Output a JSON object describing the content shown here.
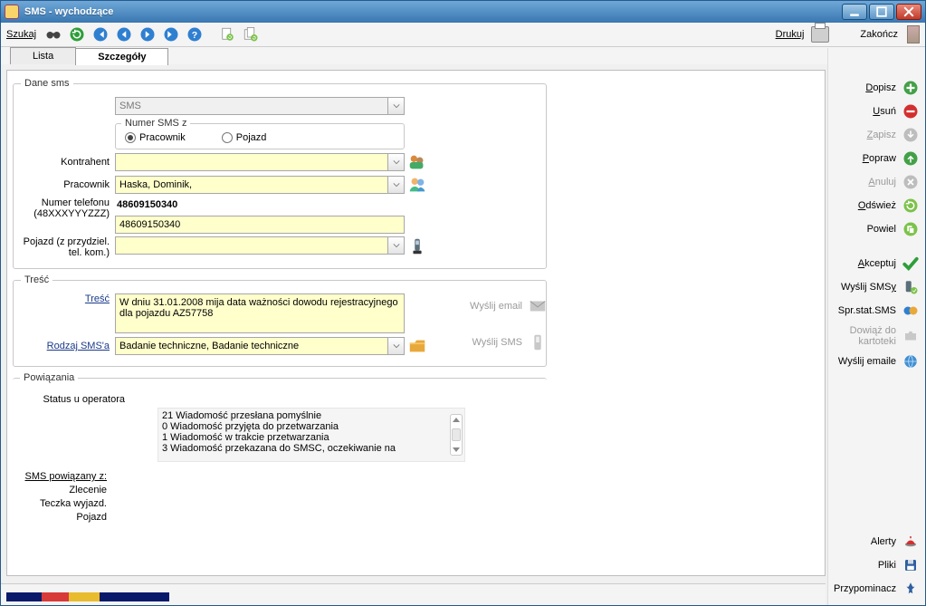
{
  "window": {
    "title": "SMS - wychodzące"
  },
  "toolbar": {
    "search_label": "Szukaj",
    "print_label": "Drukuj",
    "exit_label": "Zakończ"
  },
  "tabs": {
    "list": "Lista",
    "details": "Szczegóły"
  },
  "groups": {
    "dane": "Dane sms",
    "numer": "Numer SMS z",
    "tresc": "Treść",
    "powiazania": "Powiązania"
  },
  "fields": {
    "type_value": "SMS",
    "radio_pracownik": "Pracownik",
    "radio_pojazd": "Pojazd",
    "kontrahent_label": "Kontrahent",
    "kontrahent_value": "",
    "pracownik_label": "Pracownik",
    "pracownik_value": "Haska, Dominik,",
    "telefon_label_l1": "Numer telefonu",
    "telefon_label_l2": "(48XXXYYYZZZ)",
    "telefon_bold": "48609150340",
    "telefon_value": "48609150340",
    "pojazd_label_l1": "Pojazd (z przydziel.",
    "pojazd_label_l2": "tel. kom.)",
    "pojazd_value": "",
    "tresc_label": "Treść",
    "tresc_value": "W dniu 31.01.2008 mija data ważności dowodu rejestracyjnego dla pojazdu AZ57758",
    "rodzaj_label": "Rodzaj SMS'a",
    "rodzaj_value": "Badanie techniczne, Badanie techniczne",
    "send_email": "Wyślij email",
    "send_sms": "Wyślij SMS",
    "status_label": "Status u operatora",
    "status_lines": [
      "21 Wiadomość przesłana pomyślnie",
      "0 Wiadomość przyjęta do przetwarzania",
      "1 Wiadomość w trakcie przetwarzania",
      "3 Wiadomość przekazana do SMSC, oczekiwanie na"
    ],
    "linked_header": "SMS powiązany z:",
    "linked_zlecenie": "Zlecenie",
    "linked_teczka": "Teczka wyjazd.",
    "linked_pojazd": "Pojazd"
  },
  "actions": {
    "dopisz": "Dopisz",
    "usun": "Usuń",
    "zapisz": "Zapisz",
    "popraw": "Popraw",
    "anuluj": "Anuluj",
    "odswiez": "Odśwież",
    "powiel": "Powiel",
    "akceptuj": "Akceptuj",
    "wyslij_smsy": "Wyślij SMSy",
    "spr_stat": "Spr.stat.SMS",
    "dowiaz": "Dowiąż do kartoteki",
    "wyslij_emaile": "Wyślij emaile",
    "alerty": "Alerty",
    "pliki": "Pliki",
    "przypominacz": "Przypominacz"
  },
  "colors": {
    "yellow": "#ffffcc",
    "green": "#43a047",
    "red": "#d32f2f",
    "blue": "#1f66c1",
    "grey": "#bdbdbd"
  }
}
